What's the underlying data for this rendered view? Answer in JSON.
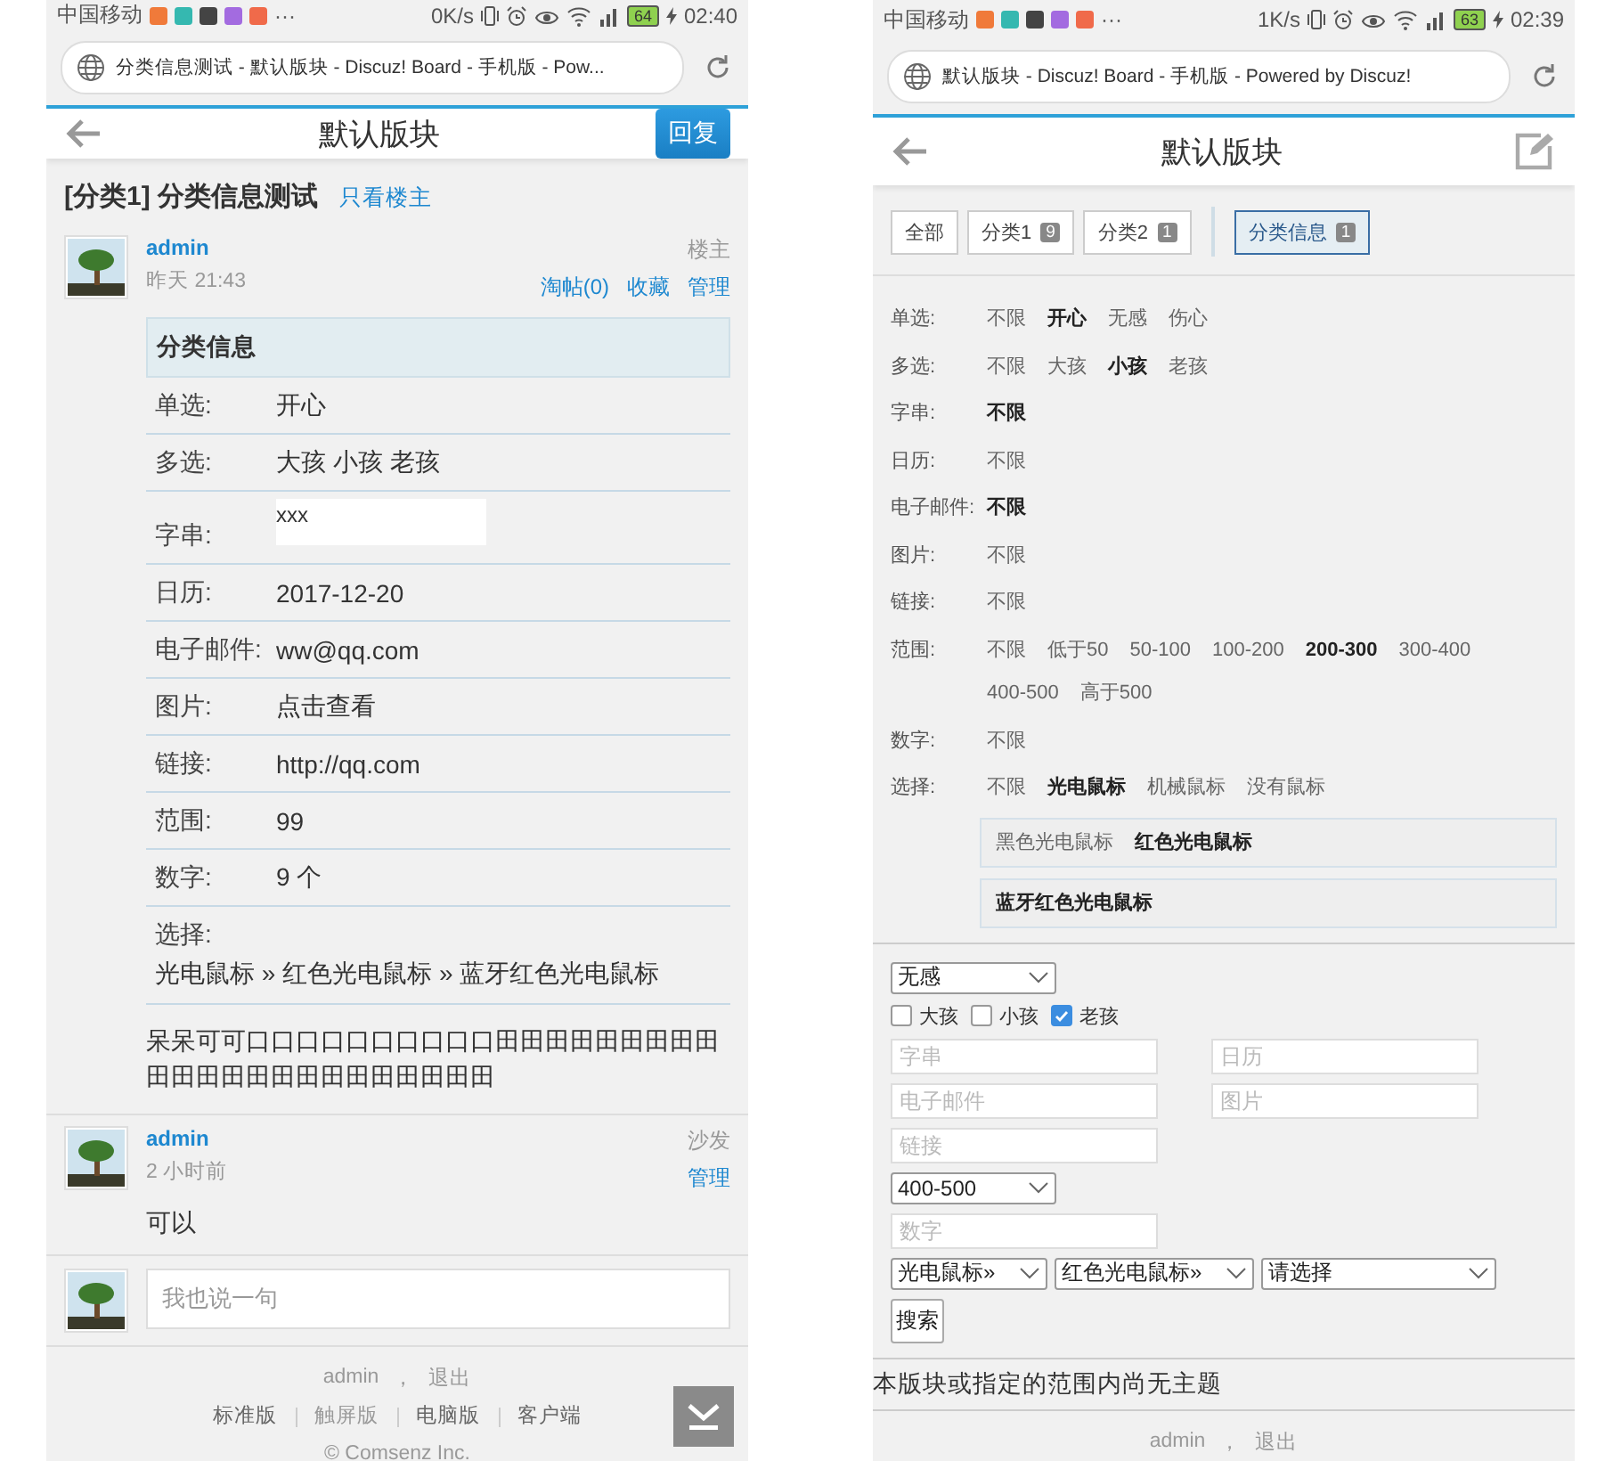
{
  "thread_screen": {
    "status_bar": {
      "carrier": "中国移动",
      "more": "···",
      "speed": "0K/s",
      "battery": "64",
      "time": "02:40"
    },
    "address_bar": {
      "title": "分类信息测试 - 默认版块 - Discuz! Board - 手机版 - Pow..."
    },
    "header": {
      "title": "默认版块",
      "reply_button": "回复"
    },
    "thread": {
      "title": "[分类1] 分类信息测试",
      "author_only_link": "只看楼主"
    },
    "posts": [
      {
        "author": "admin",
        "time": "昨天 21:43",
        "floor": "楼主",
        "actions": [
          "淘帖(0)",
          "收藏",
          "管理"
        ],
        "info_table": {
          "title": "分类信息",
          "rows": [
            {
              "kind": "inline",
              "label": "单选:",
              "value": "开心"
            },
            {
              "kind": "inline",
              "label": "多选:",
              "value": "大孩 小孩 老孩"
            },
            {
              "kind": "boxed",
              "label": "字串:",
              "value": "xxx"
            },
            {
              "kind": "inline",
              "label": "日历:",
              "value": "2017-12-20"
            },
            {
              "kind": "inline",
              "label": "电子邮件:",
              "value": "ww@qq.com"
            },
            {
              "kind": "inline",
              "label": "图片:",
              "value": "点击查看"
            },
            {
              "kind": "inline",
              "label": "链接:",
              "value": "http://qq.com"
            },
            {
              "kind": "inline",
              "label": "范围:",
              "value": "99"
            },
            {
              "kind": "inline",
              "label": "数字:",
              "value": "9 个"
            },
            {
              "kind": "stacked",
              "label": "选择:",
              "value": "光电鼠标 » 红色光电鼠标 » 蓝牙红色光电鼠标"
            }
          ]
        },
        "body": "呆呆可可口口口口口口口口口口田田田田田田田田田田田田田田田田田田田田田田田"
      },
      {
        "author": "admin",
        "time": "2 小时前",
        "floor": "沙发",
        "actions": [
          "管理"
        ],
        "body": "可以"
      }
    ],
    "reply_box": {
      "placeholder": "我也说一句"
    },
    "footer": {
      "user": "admin",
      "separator": "，",
      "logout": "退出",
      "links": [
        {
          "label": "标准版",
          "selected": false
        },
        {
          "label": "触屏版",
          "selected": true
        },
        {
          "label": "电脑版",
          "selected": false
        },
        {
          "label": "客户端",
          "selected": false
        }
      ],
      "copyright": "© Comsenz Inc."
    }
  },
  "forum_screen": {
    "status_bar": {
      "carrier": "中国移动",
      "more": "···",
      "speed": "1K/s",
      "battery": "63",
      "time": "02:39"
    },
    "address_bar": {
      "title": "默认版块 - Discuz! Board - 手机版 - Powered by Discuz!"
    },
    "header": {
      "title": "默认版块"
    },
    "tabs": [
      {
        "kind": "category",
        "label": "全部",
        "selected": false
      },
      {
        "kind": "category",
        "label": "分类1",
        "count": "9",
        "selected": false
      },
      {
        "kind": "category",
        "label": "分类2",
        "count": "1",
        "selected": false
      },
      {
        "kind": "type",
        "label": "分类信息",
        "count": "1",
        "selected": true
      }
    ],
    "filters": [
      {
        "label": "单选:",
        "options": [
          {
            "label": "不限",
            "selected": false
          },
          {
            "label": "开心",
            "selected": true
          },
          {
            "label": "无感",
            "selected": false
          },
          {
            "label": "伤心",
            "selected": false
          }
        ]
      },
      {
        "label": "多选:",
        "options": [
          {
            "label": "不限",
            "selected": false
          },
          {
            "label": "大孩",
            "selected": false
          },
          {
            "label": "小孩",
            "selected": true
          },
          {
            "label": "老孩",
            "selected": false
          }
        ]
      },
      {
        "label": "字串:",
        "options": [
          {
            "label": "不限",
            "selected": true
          }
        ]
      },
      {
        "label": "日历:",
        "options": [
          {
            "label": "不限",
            "selected": false
          }
        ]
      },
      {
        "label": "电子邮件:",
        "options": [
          {
            "label": "不限",
            "selected": true
          }
        ]
      },
      {
        "label": "图片:",
        "options": [
          {
            "label": "不限",
            "selected": false
          }
        ]
      },
      {
        "label": "链接:",
        "options": [
          {
            "label": "不限",
            "selected": false
          }
        ]
      },
      {
        "label": "范围:",
        "options": [
          {
            "label": "不限",
            "selected": false
          },
          {
            "label": "低于50",
            "selected": false
          },
          {
            "label": "50-100",
            "selected": false
          },
          {
            "label": "100-200",
            "selected": false
          },
          {
            "label": "200-300",
            "selected": true
          },
          {
            "label": "300-400",
            "selected": false
          },
          {
            "label": "400-500",
            "selected": false
          },
          {
            "label": "高于500",
            "selected": false
          }
        ]
      },
      {
        "label": "数字:",
        "options": [
          {
            "label": "不限",
            "selected": false
          }
        ]
      },
      {
        "label": "选择:",
        "options": [
          {
            "label": "不限",
            "selected": false
          },
          {
            "label": "光电鼠标",
            "selected": true
          },
          {
            "label": "机械鼠标",
            "selected": false
          },
          {
            "label": "没有鼠标",
            "selected": false
          }
        ],
        "subgroups": [
          {
            "options": [
              {
                "label": "黑色光电鼠标",
                "selected": false
              },
              {
                "label": "红色光电鼠标",
                "selected": true
              }
            ]
          },
          {
            "options": [
              {
                "label": "蓝牙红色光电鼠标",
                "selected": true
              }
            ]
          }
        ]
      }
    ],
    "form_rows": [
      {
        "kind": "selects",
        "values": [
          "无感"
        ]
      },
      {
        "kind": "checks",
        "items": [
          {
            "label": "大孩",
            "checked": false
          },
          {
            "label": "小孩",
            "checked": false
          },
          {
            "label": "老孩",
            "checked": true
          }
        ]
      },
      {
        "kind": "fields",
        "placeholders": [
          "字串",
          "日历"
        ]
      },
      {
        "kind": "fields",
        "placeholders": [
          "电子邮件",
          "图片"
        ]
      },
      {
        "kind": "fields",
        "placeholders": [
          "链接"
        ]
      },
      {
        "kind": "selects",
        "values": [
          "400-500"
        ]
      },
      {
        "kind": "fields",
        "placeholders": [
          "数字"
        ]
      },
      {
        "kind": "selects",
        "values": [
          "光电鼠标»",
          "红色光电鼠标»",
          "请选择"
        ]
      },
      {
        "kind": "button",
        "label": "搜索"
      }
    ],
    "empty_message": "本版块或指定的范围内尚无主题",
    "footer": {
      "user": "admin",
      "separator": "，",
      "logout": "退出"
    }
  }
}
